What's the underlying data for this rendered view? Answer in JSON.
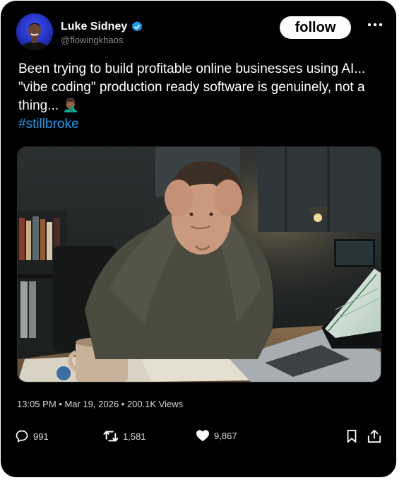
{
  "author": {
    "name": "Luke Sidney",
    "handle": "@flowingkhaos"
  },
  "follow_label": "follow",
  "tweet": {
    "text": "Been trying to build profitable online businesses using AI... \"vibe coding\" production ready software is genuinely, not a thing... 🤦🏾‍♂️",
    "hashtag": "#stillbroke"
  },
  "meta": {
    "time": "13:05 PM",
    "date": "Mar 19, 2026",
    "views": "200.1K Views"
  },
  "stats": {
    "replies": "991",
    "retweets": "1,581",
    "likes": "9,867"
  },
  "colors": {
    "background": "#000000",
    "link": "#1d9bf0",
    "verified": "#1d9bf0"
  },
  "icons": [
    "verified-badge-icon",
    "more-icon",
    "reply-icon",
    "retweet-icon",
    "like-icon",
    "bookmark-icon",
    "share-icon"
  ]
}
